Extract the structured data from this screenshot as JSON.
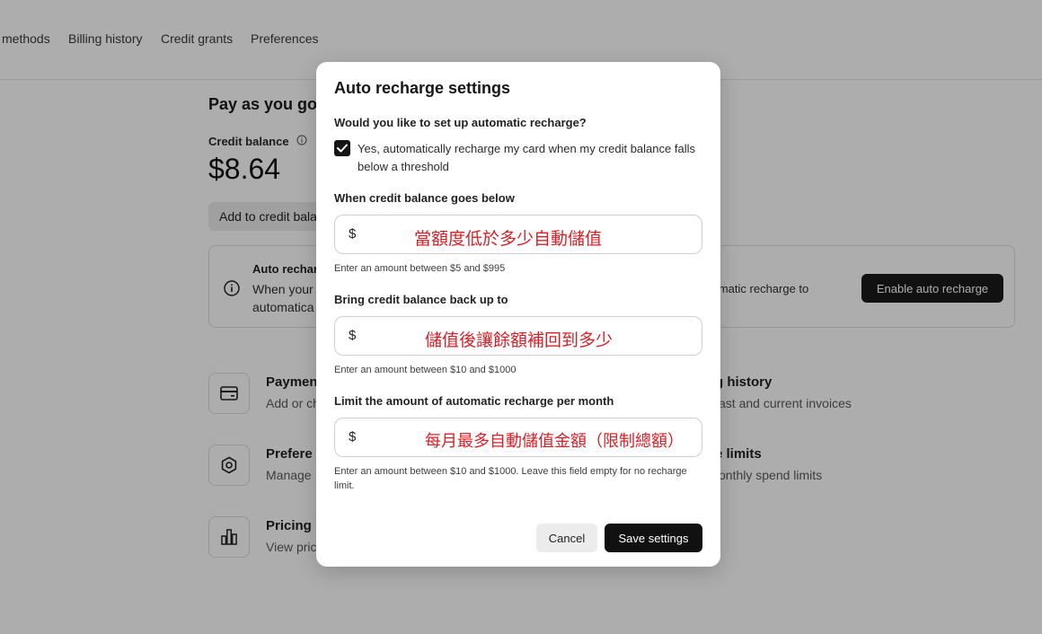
{
  "tabs": [
    "methods",
    "Billing history",
    "Credit grants",
    "Preferences"
  ],
  "main": {
    "title": "Pay as you go",
    "credit_balance_label": "Credit balance",
    "balance": "$8.64",
    "add_credit_button": "Add to credit bala",
    "auto_card": {
      "title": "Auto recharg",
      "line1": "When your c",
      "line2": "automatica",
      "right_text": "tomatic recharge to",
      "button": "Enable auto recharge"
    },
    "features": [
      {
        "title": "Paymen",
        "sub": "Add or ch",
        "icon": "credit-card-icon"
      },
      {
        "title": "Prefere",
        "sub": "Manage",
        "icon": "gear-icon"
      },
      {
        "title": "Pricing",
        "sub": "View pric",
        "icon": "bar-chart-icon"
      }
    ],
    "features_right": [
      {
        "title": "g history",
        "sub": "ast and current invoices"
      },
      {
        "title": "e limits",
        "sub": "onthly spend limits"
      }
    ]
  },
  "modal": {
    "title": "Auto recharge settings",
    "question": "Would you like to set up automatic recharge?",
    "checkbox_label": "Yes, automatically recharge my card when my credit balance falls below a threshold",
    "checkbox_checked": true,
    "fields": [
      {
        "label": "When credit balance goes below",
        "prefix": "$",
        "placeholder": "當額度低於多少自動儲值",
        "help": "Enter an amount between $5 and $995"
      },
      {
        "label": "Bring credit balance back up to",
        "prefix": "$",
        "placeholder": "儲值後讓餘額補回到多少",
        "help": "Enter an amount between $10 and $1000"
      },
      {
        "label": "Limit the amount of automatic recharge per month",
        "prefix": "$",
        "placeholder": "每月最多自動儲值金額（限制總額）",
        "help": "Enter an amount between $10 and $1000. Leave this field empty for no recharge limit."
      }
    ],
    "cancel": "Cancel",
    "save": "Save settings"
  },
  "colors": {
    "annotation_red": "#d91f26",
    "primary_button": "#111111",
    "overlay": "rgba(0,0,0,0.32)"
  }
}
